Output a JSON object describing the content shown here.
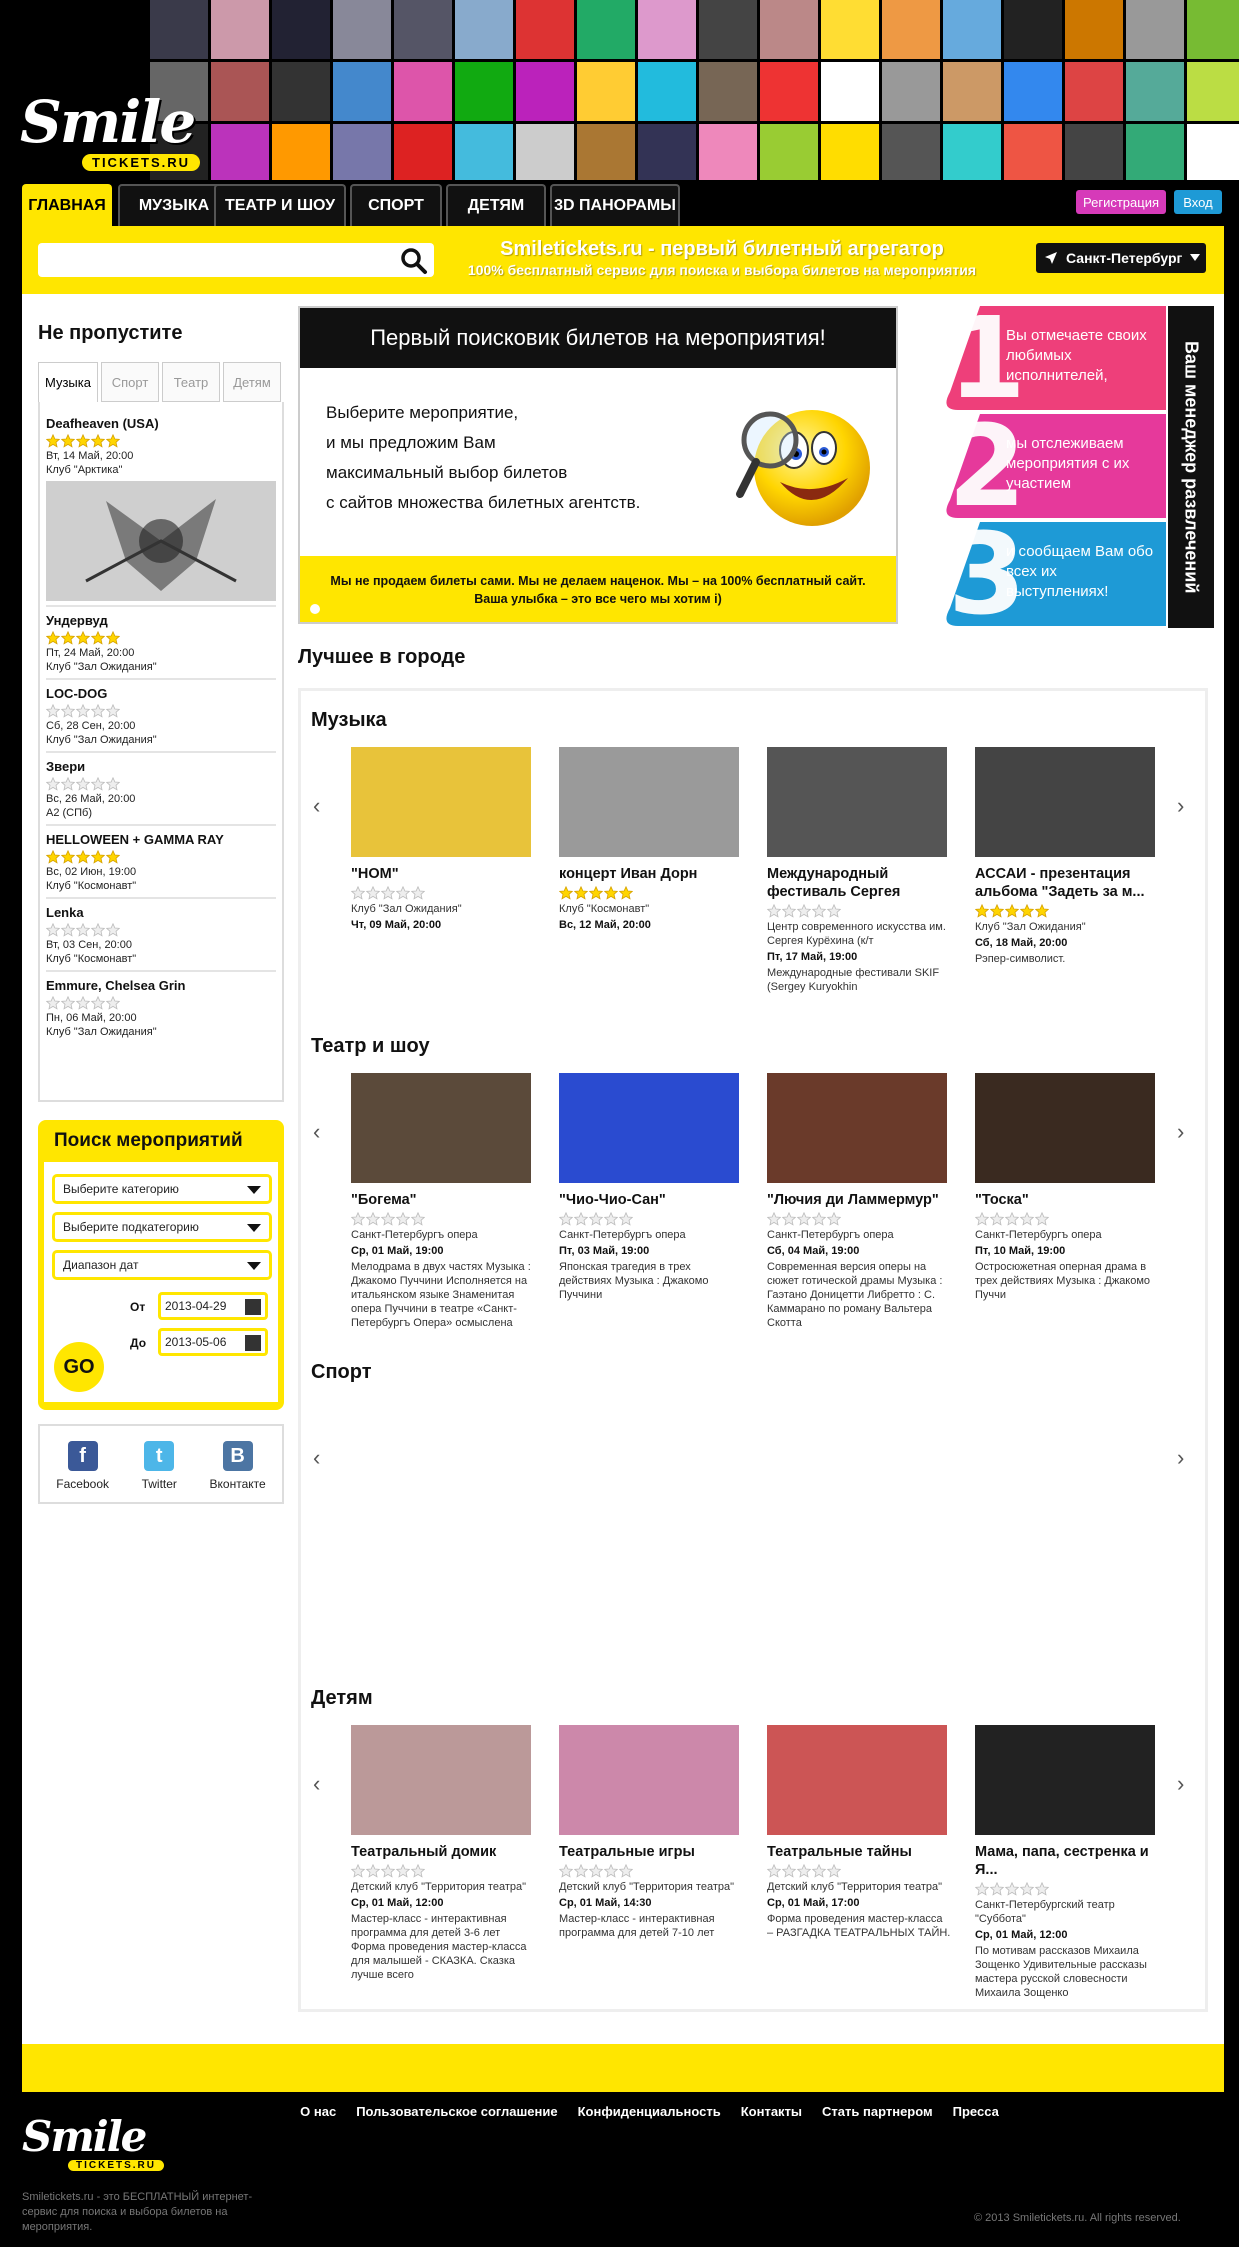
{
  "header": {
    "logo_text": "Smile",
    "logo_sub": "TICKETS.RU",
    "collage_colors": [
      "#3a3a4a",
      "#c9a",
      "#223",
      "#889",
      "#556",
      "#8ac",
      "#d33",
      "#2a6",
      "#d9c",
      "#444",
      "#b88",
      "#fd3",
      "#e94",
      "#6ad",
      "#222",
      "#c70",
      "#999",
      "#7b3",
      "#666",
      "#a55",
      "#333",
      "#48c",
      "#d5a",
      "#1a1",
      "#b2b",
      "#fc3",
      "#2bd",
      "#765",
      "#e33",
      "#fff",
      "#999",
      "#c96",
      "#38e",
      "#d44",
      "#5a9",
      "#bd4",
      "#222",
      "#b3b",
      "#f90",
      "#77a",
      "#d22",
      "#4bd",
      "#ccc",
      "#a73",
      "#335",
      "#e8b",
      "#9c3",
      "#fd0",
      "#555",
      "#3cc",
      "#e54",
      "#444",
      "#3a7",
      "#fff"
    ]
  },
  "nav": {
    "tabs": [
      "ГЛАВНАЯ",
      "МУЗЫКА",
      "ТЕАТР И ШОУ",
      "СПОРТ",
      "ДЕТЯМ",
      "3D ПАНОРАМЫ"
    ],
    "register": "Регистрация",
    "login": "Вход"
  },
  "search": {
    "placeholder": "",
    "tagline": "Smiletickets.ru - первый билетный агрегатор",
    "subtagline": "100% бесплатный сервис для поиска и выбора билетов на мероприятия",
    "city": "Санкт-Петербург"
  },
  "sidebar": {
    "title": "Не пропустите",
    "tabs": [
      "Музыка",
      "Спорт",
      "Театр",
      "Детям"
    ],
    "events": [
      {
        "title": "Deafheaven (USA)",
        "rating": 5,
        "date": "Вт, 14 Май, 20:00",
        "venue": "Клуб \"Арктика\""
      },
      {
        "title": "Ундервуд",
        "rating": 5,
        "date": "Пт, 24 Май, 20:00",
        "venue": "Клуб \"Зал Ожидания\""
      },
      {
        "title": "LOC-DOG",
        "rating": 0,
        "date": "Сб, 28 Сен, 20:00",
        "venue": "Клуб \"Зал Ожидания\""
      },
      {
        "title": "Звери",
        "rating": 0,
        "date": "Вс, 26 Май, 20:00",
        "venue": "A2 (СПб)"
      },
      {
        "title": "HELLOWEEN + GAMMA RAY",
        "rating": 5,
        "date": "Вс, 02 Июн, 19:00",
        "venue": "Клуб \"Космонавт\""
      },
      {
        "title": "Lenka",
        "rating": 0,
        "date": "Вт, 03 Сен, 20:00",
        "venue": "Клуб \"Космонавт\""
      },
      {
        "title": "Emmure, Chelsea Grin",
        "rating": 0,
        "date": "Пн, 06 Май, 20:00",
        "venue": "Клуб \"Зал Ожидания\""
      }
    ],
    "search_widget": {
      "title": "Поиск мероприятий",
      "category": "Выберите категорию",
      "subcategory": "Выберите подкатегорию",
      "date_range": "Диапазон дат",
      "from_label": "От",
      "from_value": "2013-04-29",
      "to_label": "До",
      "to_value": "2013-05-06",
      "go": "GO"
    },
    "social": [
      {
        "name": "Facebook",
        "glyph": "f",
        "color": "#3b5998"
      },
      {
        "name": "Twitter",
        "glyph": "t",
        "color": "#4db6e8"
      },
      {
        "name": "Вконтакте",
        "glyph": "B",
        "color": "#4c75a3"
      }
    ]
  },
  "promo": {
    "head": "Первый поисковик билетов на мероприятия!",
    "lines": [
      "Выберите мероприятие,",
      "и мы предложим Вам",
      "максимальный выбор билетов",
      "с сайтов множества билетных агентств."
    ],
    "foot1": "Мы не продаем билеты сами. Мы не делаем наценок. Мы – на 100% бесплатный сайт.",
    "foot2": "Ваша улыбка – это все чего мы хотим i)"
  },
  "steps": {
    "side": "Ваш менеджер развлечений",
    "items": [
      {
        "num": "1",
        "text": "Вы отмечаете своих любимых исполнителей,",
        "color": "#ee3f7a"
      },
      {
        "num": "2",
        "text": "мы отслеживаем мероприятия с их участием",
        "color": "#e6399b"
      },
      {
        "num": "3",
        "text": "и сообщаем Вам обо всех их выступлениях!",
        "color": "#1e9ad6"
      }
    ]
  },
  "best": {
    "title": "Лучшее в городе",
    "categories": [
      {
        "name": "Музыка",
        "cards": [
          {
            "title": "\"НОМ\"",
            "rating": 0,
            "venue": "Клуб \"Зал Ожидания\"",
            "date": "Чт, 09 Май, 20:00",
            "desc": "",
            "color": "#e8c33a"
          },
          {
            "title": "концерт Иван Дорн",
            "rating": 5,
            "venue": "Клуб \"Космонавт\"",
            "date": "Вс, 12 Май, 20:00",
            "desc": "",
            "color": "#9a9a9a"
          },
          {
            "title": "Международный фестиваль Сергея Курёхина ...",
            "rating": 0,
            "venue": "Центр современного искусства им. Сергея Курёхина (к/т",
            "date": "Пт, 17 Май, 19:00",
            "desc": "Международные фестивали SKIF (Sergey Kuryokhin",
            "color": "#555"
          },
          {
            "title": "АССАИ - презентация альбома \"Задеть за м...",
            "rating": 5,
            "venue": "Клуб \"Зал Ожидания\"",
            "date": "Сб, 18 Май, 20:00",
            "desc": "Рэпер-символист.",
            "color": "#444"
          }
        ]
      },
      {
        "name": "Театр и шоу",
        "cards": [
          {
            "title": "\"Богема\"",
            "rating": 0,
            "venue": "Санкт-Петербургъ опера",
            "date": "Ср, 01 Май, 19:00",
            "desc": "Мелодрама в двух частях Музыка : Джакомо Пуччини Исполняется на итальянском языке Знаменитая опера Пуччини в театре «Санкт-Петербургъ Опера» осмыслена",
            "color": "#5b4a3a"
          },
          {
            "title": "\"Чио-Чио-Сан\"",
            "rating": 0,
            "venue": "Санкт-Петербургъ опера",
            "date": "Пт, 03 Май, 19:00",
            "desc": "Японская трагедия в трех действиях Музыка : Джакомо Пуччини",
            "color": "#2a4bd0"
          },
          {
            "title": "\"Лючия ди Ламмермур\"",
            "rating": 0,
            "venue": "Санкт-Петербургъ опера",
            "date": "Сб, 04 Май, 19:00",
            "desc": "Современная версия оперы на сюжет готической драмы Музыка : Гаэтано Доницетти Либретто : С. Каммарано по роману Вальтера Скотта",
            "color": "#6a3a2a"
          },
          {
            "title": "\"Тоска\"",
            "rating": 0,
            "venue": "Санкт-Петербургъ опера",
            "date": "Пт, 10 Май, 19:00",
            "desc": "Остросюжетная оперная драма в трех действиях Музыка : Джакомо Пуччи",
            "color": "#3a2a20"
          }
        ]
      },
      {
        "name": "Спорт",
        "cards": []
      },
      {
        "name": "Детям",
        "cards": [
          {
            "title": "Театральный домик",
            "rating": 0,
            "venue": "Детский клуб \"Территория театра\"",
            "date": "Ср, 01 Май, 12:00",
            "desc": "Мастер-класс - интерактивная программа для детей 3-6 лет Форма проведения мастер-класса для малышей - СКАЗКА. Сказка лучше всего",
            "color": "#b99"
          },
          {
            "title": "Театральные игры",
            "rating": 0,
            "venue": "Детский клуб \"Территория театра\"",
            "date": "Ср, 01 Май, 14:30",
            "desc": "Мастер-класс - интерактивная программа для детей 7-10 лет",
            "color": "#c8a"
          },
          {
            "title": "Театральные тайны",
            "rating": 0,
            "venue": "Детский клуб \"Территория театра\"",
            "date": "Ср, 01 Май, 17:00",
            "desc": "Форма проведения мастер-класса – РАЗГАДКА ТЕАТРАЛЬНЫХ ТАЙН.",
            "color": "#c55"
          },
          {
            "title": "Мама, папа, сестренка и Я...",
            "rating": 0,
            "venue": "Санкт-Петербургский театр \"Суббота\"",
            "date": "Ср, 01 Май, 12:00",
            "desc": "По мотивам рассказов Михаила Зощенко Удивительные рассказы мастера русской словесности Михаила Зощенко",
            "color": "#222"
          }
        ]
      }
    ]
  },
  "footer": {
    "links": [
      "О нас",
      "Пользовательское соглашение",
      "Конфиденциальность",
      "Контакты",
      "Стать партнером",
      "Пресса"
    ],
    "logo_text": "Smile",
    "logo_sub": "TICKETS.RU",
    "desc": "Smiletickets.ru - это БЕСПЛАТНЫЙ интернет-сервис для поиска и выбора билетов на мероприятия.",
    "copyright": "© 2013 Smiletickets.ru. All rights reserved."
  }
}
